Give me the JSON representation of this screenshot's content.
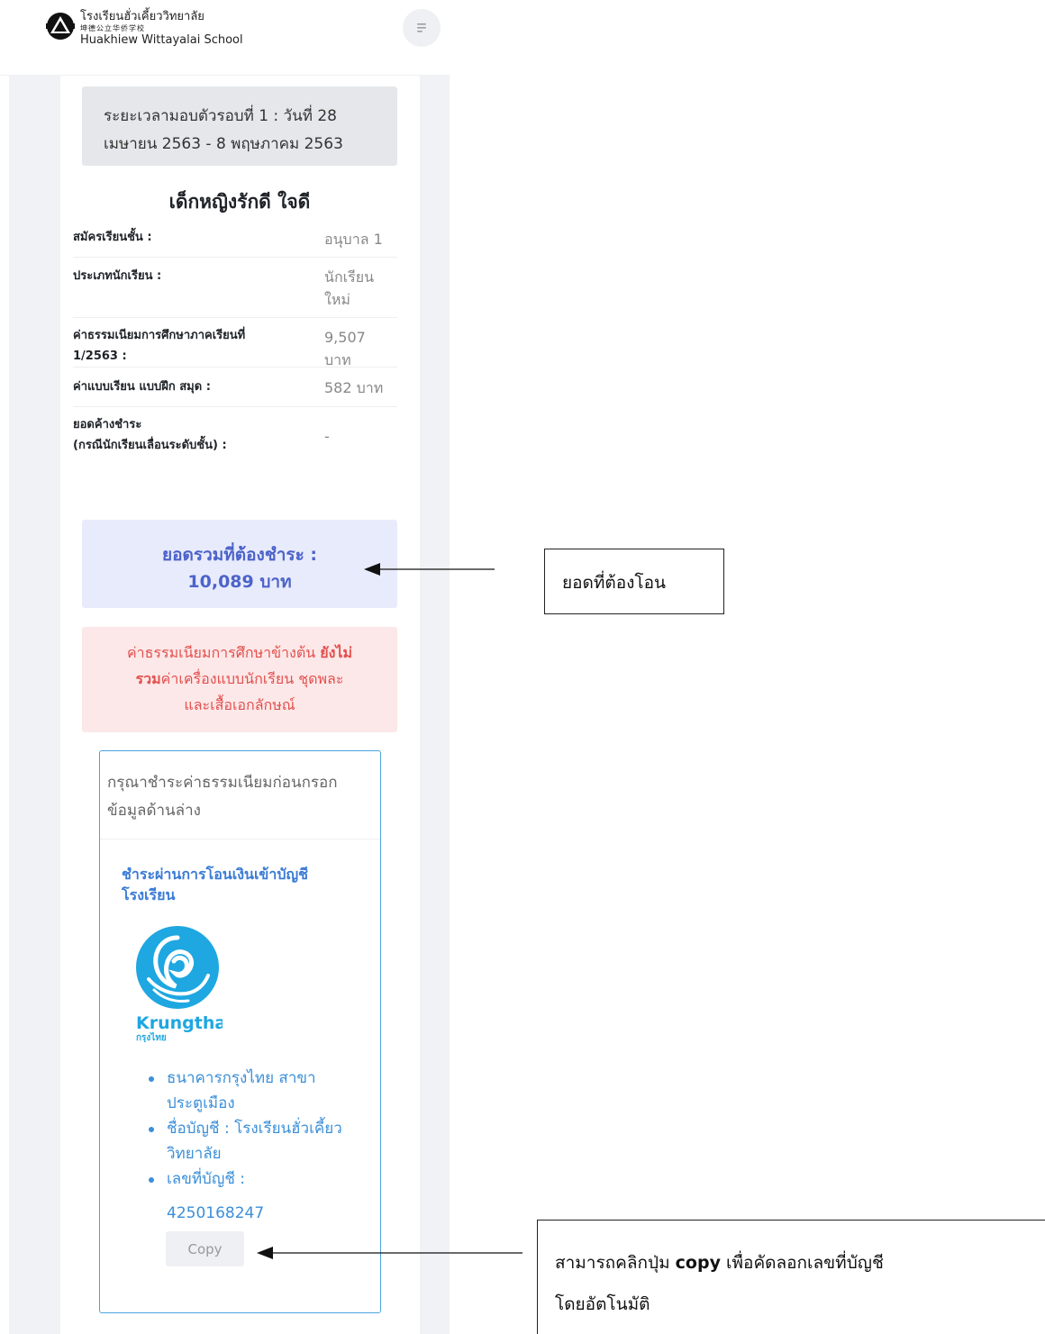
{
  "header": {
    "school_name_th": "โรงเรียนฮั่วเคี้ยววิทยาลัย",
    "school_name_cn": "坤德公立华侨学校",
    "school_name_en": "Huakhiew Wittayalai School",
    "menu_icon": "menu-icon"
  },
  "period": {
    "line1": "ระยะเวลามอบตัวรอบที่ 1 : วันที่ 28",
    "line2": "เมษายน 2563 - 8 พฤษภาคม 2563"
  },
  "student": {
    "name": "เด็กหญิงรักดี ใจดี"
  },
  "info": [
    {
      "key": "สมัครเรียนชั้น :",
      "value": "อนุบาล 1"
    },
    {
      "key": "ประเภทนักเรียน :",
      "value1": "นักเรียน",
      "value2": "ใหม่"
    },
    {
      "key1": "ค่าธรรมเนียมการศึกษาภาคเรียนที่",
      "key2": "1/2563 :",
      "value1": "9,507",
      "value2": "บาท"
    },
    {
      "key": "ค่าแบบเรียน แบบฝึก สมุด :",
      "value": "582 บาท"
    },
    {
      "key1": "ยอดค้างชำระ",
      "key2": "(กรณีนักเรียนเลื่อนระดับชั้น) :",
      "value": "-"
    }
  ],
  "total": {
    "label": "ยอดรวมที่ต้องชำระ :",
    "amount": "10,089 บาท"
  },
  "warning": {
    "part1": "ค่าธรรมเนียมการศึกษาข้างต้น ",
    "bold1": "ยังไม่",
    "bold2": "รวม",
    "part2": "ค่าเครื่องแบบนักเรียน ชุดพละ",
    "part3": "และเสื้อเอกลักษณ์"
  },
  "payment": {
    "head_line1": "กรุณาชำระค่าธรรมเนียมก่อนกรอก",
    "head_line2": "ข้อมูลด้านล่าง",
    "title_line1": "ชำระผ่านการโอนเงินเข้าบัญชี",
    "title_line2": "โรงเรียน",
    "bank_logo_text": "Krungthai",
    "bank_logo_sub": "กรุงไทย",
    "bank_items": [
      {
        "l1": "ธนาคารกรุงไทย สาขา",
        "l2": "ประตูเมือง"
      },
      {
        "l1": "ชื่อบัญชี : โรงเรียนฮั่วเคี้ยว",
        "l2": "วิทยาลัย"
      },
      {
        "l1": "เลขที่บัญชี :",
        "l2": ""
      }
    ],
    "account_number": "4250168247",
    "copy_label": "Copy"
  },
  "annotations": {
    "note1": "ยอดที่ต้องโอน",
    "note2_pre": "สามารถคลิกปุ่ม ",
    "note2_bold": "copy",
    "note2_post": " เพื่อคัดลอกเลขที่บัญชี",
    "note2_line2": "โดยอัตโนมัติ"
  },
  "colors": {
    "accent_blue": "#4c63c9",
    "link_blue": "#3b8fd8",
    "warn_red": "#e2504f",
    "card_border": "#4aa3df"
  }
}
